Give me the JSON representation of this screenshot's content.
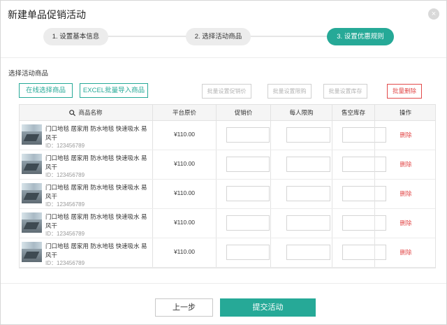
{
  "dialog": {
    "title": "新建单品促销活动",
    "close_icon": "×"
  },
  "steps": [
    {
      "label": "1. 设置基本信息",
      "active": false
    },
    {
      "label": "2. 选择活动商品",
      "active": false
    },
    {
      "label": "3. 设置优惠规则",
      "active": true
    }
  ],
  "section": {
    "label": "选择活动商品"
  },
  "toolbar": {
    "online_select": "在线选择商品",
    "excel_import": "EXCEL批量导入商品",
    "batch_price": "批量设置促销价",
    "batch_limit": "批量设置限购",
    "batch_stock": "批量设置库存",
    "batch_delete": "批量删除"
  },
  "table": {
    "headers": {
      "name": "商品名称",
      "price": "平台原价",
      "promo": "促销价",
      "limit": "每人限购",
      "stock": "售空库存",
      "action": "操作"
    },
    "rows": [
      {
        "name": "门口地毯 居家用 防水地毯 快速吸水 易风干",
        "id": "ID：123456789",
        "price": "¥110.00",
        "action": "删除"
      },
      {
        "name": "门口地毯 居家用 防水地毯 快速吸水 易风干",
        "id": "ID：123456789",
        "price": "¥110.00",
        "action": "删除"
      },
      {
        "name": "门口地毯 居家用 防水地毯 快速吸水 易风干",
        "id": "ID：123456789",
        "price": "¥110.00",
        "action": "删除"
      },
      {
        "name": "门口地毯 居家用 防水地毯 快速吸水 易风干",
        "id": "ID：123456789",
        "price": "¥110.00",
        "action": "删除"
      },
      {
        "name": "门口地毯 居家用 防水地毯 快速吸水 易风干",
        "id": "ID：123456789",
        "price": "¥110.00",
        "action": "删除"
      }
    ]
  },
  "footer": {
    "prev_label": "上一步",
    "submit_label": "提交活动"
  },
  "colors": {
    "accent": "#26a997",
    "danger": "#e24a4a"
  }
}
